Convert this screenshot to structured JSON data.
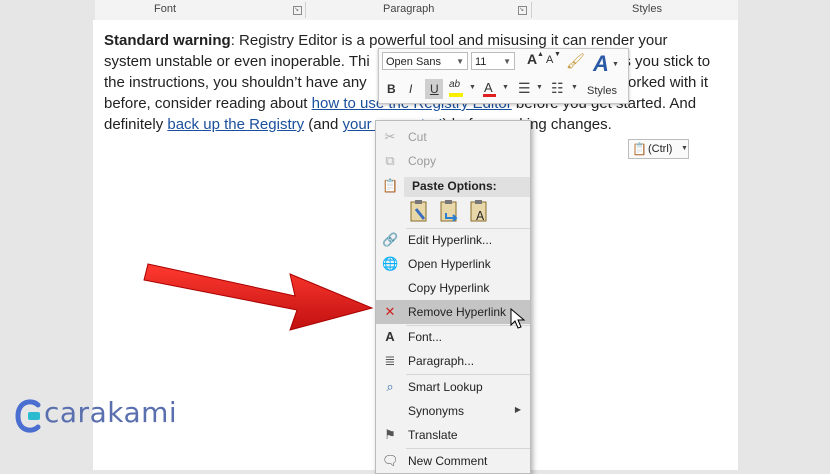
{
  "ribbon": {
    "groups": [
      "Font",
      "Paragraph",
      "Styles"
    ]
  },
  "doc": {
    "l1_bold": "Standard warning",
    "l1_rest": ": Registry Editor is a powerful tool and misusing it can render your",
    "l2_a": "system unstable or even inoperable. Thi",
    "l2_b": "as you stick to",
    "l3_a": "the instructions, you shouldn’t have any",
    "l3_b": "orked with it",
    "l4_a": "before, consider reading about ",
    "l4_link": "how to use the Registry Editor",
    "l4_b": " before you get started. And",
    "l5_a": "definitely ",
    "l5_link1": "back up the Registry",
    "l5_b": " (and ",
    "l5_link2": "your computer!",
    "l5_c": ") before making changes."
  },
  "mini_toolbar": {
    "font_name": "Open Sans",
    "font_size": "11",
    "bold": "B",
    "italic": "I",
    "underline": "U",
    "grow_font": "A",
    "shrink_font": "A",
    "font_color_glyph": "A",
    "styles_label": "Styles"
  },
  "paste_ctrl": {
    "label": "(Ctrl)"
  },
  "context_menu": {
    "cut": "Cut",
    "copy": "Copy",
    "paste_options": "Paste Options:",
    "edit_hyperlink": "Edit Hyperlink...",
    "open_hyperlink": "Open Hyperlink",
    "copy_hyperlink": "Copy Hyperlink",
    "remove_hyperlink": "Remove Hyperlink",
    "font": "Font...",
    "paragraph": "Paragraph...",
    "smart_lookup": "Smart Lookup",
    "synonyms": "Synonyms",
    "translate": "Translate",
    "new_comment": "New Comment"
  },
  "watermark": {
    "text": "carakami"
  },
  "colors": {
    "link": "#1a4f9c",
    "arrow": "#e0201e",
    "highlight": "#c5c5c5",
    "watermark": "#5a6fae"
  }
}
